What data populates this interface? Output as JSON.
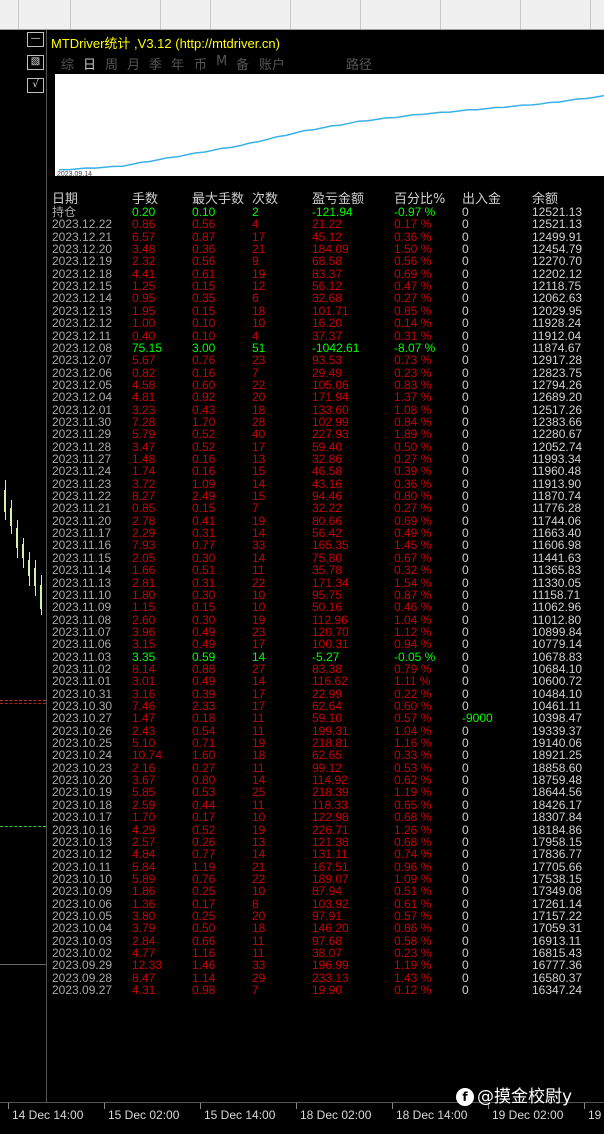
{
  "panel": {
    "title": "MTDriver统计 ,V3.12 (http://mtdriver.cn)",
    "tabs": [
      {
        "label": "综",
        "active": false
      },
      {
        "label": "日",
        "active": true
      },
      {
        "label": "周",
        "active": false
      },
      {
        "label": "月",
        "active": false
      },
      {
        "label": "季",
        "active": false
      },
      {
        "label": "年",
        "active": false
      },
      {
        "label": "币",
        "active": false
      },
      {
        "label": "M",
        "active": false
      },
      {
        "label": "备",
        "active": false
      },
      {
        "label": "账户",
        "active": false
      },
      {
        "label": "路径",
        "active": false
      }
    ],
    "balance_chart": {
      "start_label": "2023.09.14",
      "line_color": "#3ab0e8",
      "balance_trend": [
        10398,
        10500,
        10800,
        11100,
        11500,
        11800,
        12000,
        12150,
        12300,
        12521
      ]
    },
    "headers": [
      "日期",
      "手数",
      "最大手数",
      "次数",
      "盈亏金额",
      "百分比%",
      "出入金",
      "余额"
    ],
    "rows": [
      {
        "date": "持仓",
        "lots": "0.20",
        "max": "0.10",
        "cnt": "2",
        "pl": "-121.94",
        "pct": "-0.97 %",
        "io": "0",
        "bal": "12521.13",
        "loss": true
      },
      {
        "date": "2023.12.22",
        "lots": "0.86",
        "max": "0.56",
        "cnt": "4",
        "pl": "21.22",
        "pct": "0.17 %",
        "io": "0",
        "bal": "12521.13"
      },
      {
        "date": "2023.12.21",
        "lots": "6.57",
        "max": "0.87",
        "cnt": "17",
        "pl": "45.12",
        "pct": "0.36 %",
        "io": "0",
        "bal": "12499.91"
      },
      {
        "date": "2023.12.20",
        "lots": "3.48",
        "max": "0.36",
        "cnt": "21",
        "pl": "184.09",
        "pct": "1.50 %",
        "io": "0",
        "bal": "12454.79"
      },
      {
        "date": "2023.12.19",
        "lots": "2.32",
        "max": "0.56",
        "cnt": "9",
        "pl": "68.58",
        "pct": "0.56 %",
        "io": "0",
        "bal": "12270.70"
      },
      {
        "date": "2023.12.18",
        "lots": "4.41",
        "max": "0.61",
        "cnt": "19",
        "pl": "83.37",
        "pct": "0.69 %",
        "io": "0",
        "bal": "12202.12"
      },
      {
        "date": "2023.12.15",
        "lots": "1.25",
        "max": "0.15",
        "cnt": "12",
        "pl": "56.12",
        "pct": "0.47 %",
        "io": "0",
        "bal": "12118.75"
      },
      {
        "date": "2023.12.14",
        "lots": "0.95",
        "max": "0.35",
        "cnt": "6",
        "pl": "32.68",
        "pct": "0.27 %",
        "io": "0",
        "bal": "12062.63"
      },
      {
        "date": "2023.12.13",
        "lots": "1.95",
        "max": "0.15",
        "cnt": "18",
        "pl": "101.71",
        "pct": "0.85 %",
        "io": "0",
        "bal": "12029.95"
      },
      {
        "date": "2023.12.12",
        "lots": "1.00",
        "max": "0.10",
        "cnt": "10",
        "pl": "16.20",
        "pct": "0.14 %",
        "io": "0",
        "bal": "11928.24"
      },
      {
        "date": "2023.12.11",
        "lots": "0.40",
        "max": "0.10",
        "cnt": "4",
        "pl": "37.37",
        "pct": "0.31 %",
        "io": "0",
        "bal": "11912.04"
      },
      {
        "date": "2023.12.08",
        "lots": "75.15",
        "max": "3.00",
        "cnt": "51",
        "pl": "-1042.61",
        "pct": "-8.07 %",
        "io": "0",
        "bal": "11874.67",
        "loss": true
      },
      {
        "date": "2023.12.07",
        "lots": "5.67",
        "max": "0.76",
        "cnt": "23",
        "pl": "93.53",
        "pct": "0.73 %",
        "io": "0",
        "bal": "12917.28"
      },
      {
        "date": "2023.12.06",
        "lots": "0.82",
        "max": "0.16",
        "cnt": "7",
        "pl": "29.49",
        "pct": "0.23 %",
        "io": "0",
        "bal": "12823.75"
      },
      {
        "date": "2023.12.05",
        "lots": "4.58",
        "max": "0.60",
        "cnt": "22",
        "pl": "105.06",
        "pct": "0.83 %",
        "io": "0",
        "bal": "12794.26"
      },
      {
        "date": "2023.12.04",
        "lots": "4.81",
        "max": "0.92",
        "cnt": "20",
        "pl": "171.94",
        "pct": "1.37 %",
        "io": "0",
        "bal": "12689.20"
      },
      {
        "date": "2023.12.01",
        "lots": "3.23",
        "max": "0.43",
        "cnt": "18",
        "pl": "133.60",
        "pct": "1.08 %",
        "io": "0",
        "bal": "12517.26"
      },
      {
        "date": "2023.11.30",
        "lots": "7.28",
        "max": "1.70",
        "cnt": "28",
        "pl": "102.99",
        "pct": "0.84 %",
        "io": "0",
        "bal": "12383.66"
      },
      {
        "date": "2023.11.29",
        "lots": "5.79",
        "max": "0.52",
        "cnt": "40",
        "pl": "227.93",
        "pct": "1.89 %",
        "io": "0",
        "bal": "12280.67"
      },
      {
        "date": "2023.11.28",
        "lots": "3.47",
        "max": "0.52",
        "cnt": "17",
        "pl": "59.40",
        "pct": "0.50 %",
        "io": "0",
        "bal": "12052.74"
      },
      {
        "date": "2023.11.27",
        "lots": "1.48",
        "max": "0.16",
        "cnt": "13",
        "pl": "32.86",
        "pct": "0.27 %",
        "io": "0",
        "bal": "11993.34"
      },
      {
        "date": "2023.11.24",
        "lots": "1.74",
        "max": "0.16",
        "cnt": "15",
        "pl": "46.58",
        "pct": "0.39 %",
        "io": "0",
        "bal": "11960.48"
      },
      {
        "date": "2023.11.23",
        "lots": "3.72",
        "max": "1.09",
        "cnt": "14",
        "pl": "43.16",
        "pct": "0.36 %",
        "io": "0",
        "bal": "11913.90"
      },
      {
        "date": "2023.11.22",
        "lots": "8.27",
        "max": "2.49",
        "cnt": "15",
        "pl": "94.46",
        "pct": "0.80 %",
        "io": "0",
        "bal": "11870.74"
      },
      {
        "date": "2023.11.21",
        "lots": "0.85",
        "max": "0.15",
        "cnt": "7",
        "pl": "32.22",
        "pct": "0.27 %",
        "io": "0",
        "bal": "11776.28"
      },
      {
        "date": "2023.11.20",
        "lots": "2.78",
        "max": "0.41",
        "cnt": "19",
        "pl": "80.66",
        "pct": "0.69 %",
        "io": "0",
        "bal": "11744.06"
      },
      {
        "date": "2023.11.17",
        "lots": "2.29",
        "max": "0.31",
        "cnt": "14",
        "pl": "56.42",
        "pct": "0.49 %",
        "io": "0",
        "bal": "11663.40"
      },
      {
        "date": "2023.11.16",
        "lots": "7.93",
        "max": "0.77",
        "cnt": "33",
        "pl": "165.35",
        "pct": "1.45 %",
        "io": "0",
        "bal": "11606.98"
      },
      {
        "date": "2023.11.15",
        "lots": "2.05",
        "max": "0.30",
        "cnt": "14",
        "pl": "75.80",
        "pct": "0.67 %",
        "io": "0",
        "bal": "11441.63"
      },
      {
        "date": "2023.11.14",
        "lots": "1.66",
        "max": "0.51",
        "cnt": "11",
        "pl": "35.78",
        "pct": "0.32 %",
        "io": "0",
        "bal": "11365.83"
      },
      {
        "date": "2023.11.13",
        "lots": "2.81",
        "max": "0.31",
        "cnt": "22",
        "pl": "171.34",
        "pct": "1.54 %",
        "io": "0",
        "bal": "11330.05"
      },
      {
        "date": "2023.11.10",
        "lots": "1.80",
        "max": "0.30",
        "cnt": "10",
        "pl": "95.75",
        "pct": "0.87 %",
        "io": "0",
        "bal": "11158.71"
      },
      {
        "date": "2023.11.09",
        "lots": "1.15",
        "max": "0.15",
        "cnt": "10",
        "pl": "50.16",
        "pct": "0.46 %",
        "io": "0",
        "bal": "11062.96"
      },
      {
        "date": "2023.11.08",
        "lots": "2.60",
        "max": "0.30",
        "cnt": "19",
        "pl": "112.96",
        "pct": "1.04 %",
        "io": "0",
        "bal": "11012.80"
      },
      {
        "date": "2023.11.07",
        "lots": "3.96",
        "max": "0.49",
        "cnt": "23",
        "pl": "120.70",
        "pct": "1.12 %",
        "io": "0",
        "bal": "10899.84"
      },
      {
        "date": "2023.11.06",
        "lots": "3.15",
        "max": "0.49",
        "cnt": "17",
        "pl": "100.31",
        "pct": "0.94 %",
        "io": "0",
        "bal": "10779.14"
      },
      {
        "date": "2023.11.03",
        "lots": "3.35",
        "max": "0.59",
        "cnt": "14",
        "pl": "-5.27",
        "pct": "-0.05 %",
        "io": "0",
        "bal": "10678.83",
        "loss": true
      },
      {
        "date": "2023.11.02",
        "lots": "8.14",
        "max": "0.88",
        "cnt": "27",
        "pl": "83.38",
        "pct": "0.79 %",
        "io": "0",
        "bal": "10684.10"
      },
      {
        "date": "2023.11.01",
        "lots": "3.01",
        "max": "0.49",
        "cnt": "14",
        "pl": "116.62",
        "pct": "1.11 %",
        "io": "0",
        "bal": "10600.72"
      },
      {
        "date": "2023.10.31",
        "lots": "3.16",
        "max": "0.39",
        "cnt": "17",
        "pl": "22.99",
        "pct": "0.22 %",
        "io": "0",
        "bal": "10484.10"
      },
      {
        "date": "2023.10.30",
        "lots": "7.46",
        "max": "2.33",
        "cnt": "17",
        "pl": "62.64",
        "pct": "0.60 %",
        "io": "0",
        "bal": "10461.11"
      },
      {
        "date": "2023.10.27",
        "lots": "1.47",
        "max": "0.18",
        "cnt": "11",
        "pl": "59.10",
        "pct": "0.57 %",
        "io": "-9000",
        "bal": "10398.47",
        "io_neg": true
      },
      {
        "date": "2023.10.26",
        "lots": "2.43",
        "max": "0.54",
        "cnt": "11",
        "pl": "199.31",
        "pct": "1.04 %",
        "io": "0",
        "bal": "19339.37"
      },
      {
        "date": "2023.10.25",
        "lots": "5.10",
        "max": "0.71",
        "cnt": "19",
        "pl": "218.81",
        "pct": "1.16 %",
        "io": "0",
        "bal": "19140.06"
      },
      {
        "date": "2023.10.24",
        "lots": "10.74",
        "max": "1.60",
        "cnt": "18",
        "pl": "62.65",
        "pct": "0.33 %",
        "io": "0",
        "bal": "18921.25"
      },
      {
        "date": "2023.10.23",
        "lots": "2.16",
        "max": "0.27",
        "cnt": "11",
        "pl": "99.12",
        "pct": "0.53 %",
        "io": "0",
        "bal": "18858.60"
      },
      {
        "date": "2023.10.20",
        "lots": "3.67",
        "max": "0.80",
        "cnt": "14",
        "pl": "114.92",
        "pct": "0.62 %",
        "io": "0",
        "bal": "18759.48"
      },
      {
        "date": "2023.10.19",
        "lots": "5.85",
        "max": "0.53",
        "cnt": "25",
        "pl": "218.39",
        "pct": "1.19 %",
        "io": "0",
        "bal": "18644.56"
      },
      {
        "date": "2023.10.18",
        "lots": "2.59",
        "max": "0.44",
        "cnt": "11",
        "pl": "118.33",
        "pct": "0.65 %",
        "io": "0",
        "bal": "18426.17"
      },
      {
        "date": "2023.10.17",
        "lots": "1.70",
        "max": "0.17",
        "cnt": "10",
        "pl": "122.98",
        "pct": "0.68 %",
        "io": "0",
        "bal": "18307.84"
      },
      {
        "date": "2023.10.16",
        "lots": "4.29",
        "max": "0.52",
        "cnt": "19",
        "pl": "226.71",
        "pct": "1.26 %",
        "io": "0",
        "bal": "18184.86"
      },
      {
        "date": "2023.10.13",
        "lots": "2.57",
        "max": "0.26",
        "cnt": "13",
        "pl": "121.38",
        "pct": "0.68 %",
        "io": "0",
        "bal": "17958.15"
      },
      {
        "date": "2023.10.12",
        "lots": "4.84",
        "max": "0.77",
        "cnt": "14",
        "pl": "131.11",
        "pct": "0.74 %",
        "io": "0",
        "bal": "17836.77"
      },
      {
        "date": "2023.10.11",
        "lots": "5.84",
        "max": "1.19",
        "cnt": "21",
        "pl": "167.51",
        "pct": "0.96 %",
        "io": "0",
        "bal": "17705.66"
      },
      {
        "date": "2023.10.10",
        "lots": "5.89",
        "max": "0.76",
        "cnt": "22",
        "pl": "189.07",
        "pct": "1.09 %",
        "io": "0",
        "bal": "17538.15"
      },
      {
        "date": "2023.10.09",
        "lots": "1.86",
        "max": "0.25",
        "cnt": "10",
        "pl": "87.94",
        "pct": "0.51 %",
        "io": "0",
        "bal": "17349.08"
      },
      {
        "date": "2023.10.06",
        "lots": "1.36",
        "max": "0.17",
        "cnt": "8",
        "pl": "103.92",
        "pct": "0.61 %",
        "io": "0",
        "bal": "17261.14"
      },
      {
        "date": "2023.10.05",
        "lots": "3.80",
        "max": "0.25",
        "cnt": "20",
        "pl": "97.91",
        "pct": "0.57 %",
        "io": "0",
        "bal": "17157.22"
      },
      {
        "date": "2023.10.04",
        "lots": "3.79",
        "max": "0.50",
        "cnt": "18",
        "pl": "146.20",
        "pct": "0.86 %",
        "io": "0",
        "bal": "17059.31"
      },
      {
        "date": "2023.10.03",
        "lots": "2.84",
        "max": "0.66",
        "cnt": "11",
        "pl": "97.68",
        "pct": "0.58 %",
        "io": "0",
        "bal": "16913.11"
      },
      {
        "date": "2023.10.02",
        "lots": "4.77",
        "max": "1.16",
        "cnt": "11",
        "pl": "38.07",
        "pct": "0.23 %",
        "io": "0",
        "bal": "16815.43"
      },
      {
        "date": "2023.09.29",
        "lots": "12.33",
        "max": "1.46",
        "cnt": "33",
        "pl": "196.99",
        "pct": "1.19 %",
        "io": "0",
        "bal": "16777.36"
      },
      {
        "date": "2023.09.28",
        "lots": "8.47",
        "max": "1.14",
        "cnt": "29",
        "pl": "233.13",
        "pct": "1.43 %",
        "io": "0",
        "bal": "16580.37"
      },
      {
        "date": "2023.09.27",
        "lots": "4.31",
        "max": "0.98",
        "cnt": "7",
        "pl": "19.90",
        "pct": "0.12 %",
        "io": "0",
        "bal": "16347.24"
      }
    ]
  },
  "left_buttons": [
    {
      "icon": "minimize-icon",
      "glyph": "—"
    },
    {
      "icon": "settings-icon",
      "glyph": "▧"
    },
    {
      "icon": "check-icon",
      "glyph": "√"
    }
  ],
  "time_axis": [
    "14 Dec 14:00",
    "15 Dec 02:00",
    "15 Dec 14:00",
    "18 Dec 02:00",
    "18 Dec 14:00",
    "19 Dec 02:00",
    "19"
  ],
  "watermark": {
    "text": "@摸金校尉y"
  },
  "colors": {
    "profit": "#cc0000",
    "loss": "#00ff00",
    "header": "#cfcfcf",
    "title": "#ffff00"
  }
}
